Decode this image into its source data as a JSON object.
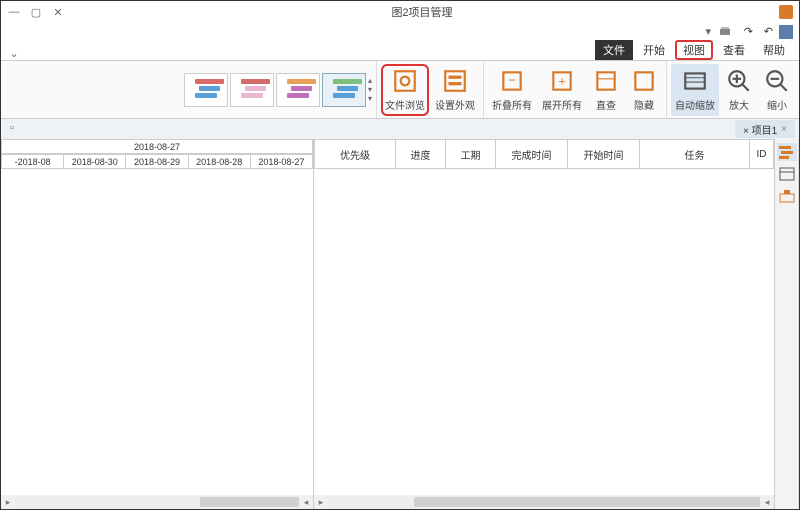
{
  "window": {
    "title": "图2项目管理"
  },
  "menu": {
    "items": [
      {
        "label": "帮助"
      },
      {
        "label": "查看"
      },
      {
        "label": "视图",
        "outlined": true
      },
      {
        "label": "开始"
      },
      {
        "label": "文件",
        "active": true
      }
    ]
  },
  "ribbon": {
    "zoom": {
      "small": "缩小",
      "large": "放大"
    },
    "auto": "自动缩放",
    "hide": "隐藏",
    "open": "展开所有",
    "collapse": "折叠所有",
    "lookup": "直查",
    "settings": "设置外观",
    "browse_red": "文件浏览"
  },
  "doctab": {
    "label": "项目1 ×"
  },
  "table_headers": [
    "ID",
    "任务",
    "开始时间",
    "完成时间",
    "工期",
    "进度",
    "优先级"
  ],
  "table_widths": [
    24,
    110,
    72,
    72,
    50,
    50,
    82
  ],
  "gantt": {
    "top": "2018-08-27",
    "days": [
      "2018-08-27",
      "2018-08-28",
      "2018-08-29",
      "2018-08-30",
      "2018-08-"
    ]
  }
}
